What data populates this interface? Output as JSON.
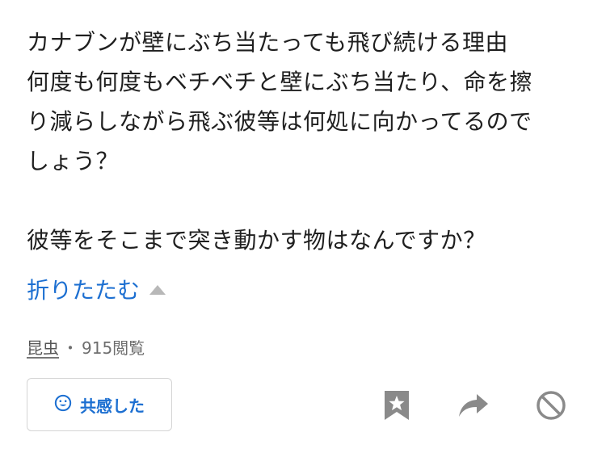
{
  "question": {
    "lines": [
      "カナブンが壁にぶち当たっても飛び続ける理由",
      "何度も何度もベチベチと壁にぶち当たり、命を擦",
      "り減らしながら飛ぶ彼等は何処に向かってるので",
      "しょう？",
      "",
      "彼等をそこまで突き動かす物はなんですか？"
    ]
  },
  "collapse": {
    "label": "折りたたむ"
  },
  "meta": {
    "category": "昆虫",
    "separator": "・",
    "views": "915閲覧"
  },
  "actions": {
    "empathy_label": "共感した",
    "icons": [
      "smile-icon",
      "bookmark-star-icon",
      "share-arrow-icon",
      "block-icon"
    ]
  },
  "colors": {
    "link": "#1c6fd1",
    "icon_gray": "#8a8a8a",
    "text": "#1f1f1f"
  }
}
